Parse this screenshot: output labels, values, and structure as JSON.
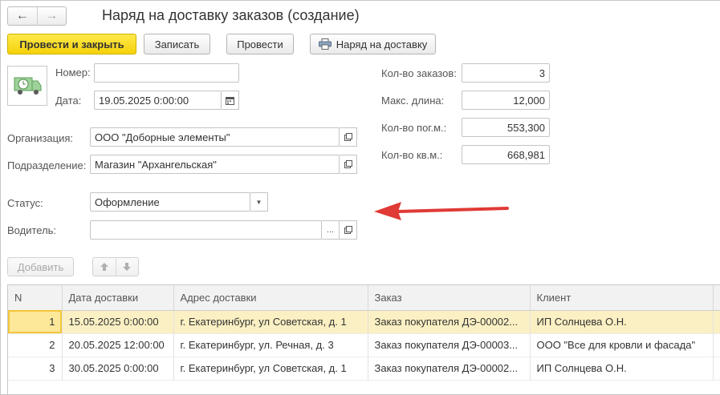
{
  "window": {
    "title": "Наряд на доставку заказов (создание)"
  },
  "nav": {
    "back": "←",
    "forward": "→"
  },
  "toolbar": {
    "post_close": "Провести и закрыть",
    "save": "Записать",
    "post": "Провести",
    "delivery_order": "Наряд на доставку"
  },
  "form": {
    "number_label": "Номер:",
    "number_value": "",
    "date_label": "Дата:",
    "date_value": "19.05.2025  0:00:00",
    "org_label": "Организация:",
    "org_value": "ООО \"Доборные элементы\"",
    "dept_label": "Подразделение:",
    "dept_value": "Магазин \"Архангельская\"",
    "status_label": "Статус:",
    "status_value": "Оформление",
    "driver_label": "Водитель:",
    "driver_value": "",
    "ellipsis": "..."
  },
  "stats": {
    "orders_label": "Кол-во заказов:",
    "orders_value": "3",
    "maxlen_label": "Макс. длина:",
    "maxlen_value": "12,000",
    "linm_label": "Кол-во пог.м.:",
    "linm_value": "553,300",
    "sqm_label": "Кол-во кв.м.:",
    "sqm_value": "668,981"
  },
  "table_toolbar": {
    "add": "Добавить",
    "up": "🡅",
    "down": "🡇"
  },
  "table": {
    "columns": [
      "N",
      "Дата доставки",
      "Адрес доставки",
      "Заказ",
      "Клиент"
    ],
    "rows": [
      [
        "1",
        "15.05.2025 0:00:00",
        "г. Екатеринбург, ул Советская, д. 1",
        "Заказ покупателя ДЭ-00002...",
        "ИП Солнцева О.Н."
      ],
      [
        "2",
        "20.05.2025 12:00:00",
        "г. Екатеринбург, ул. Речная, д. 3",
        "Заказ покупателя ДЭ-00003...",
        "ООО \"Все для кровли и фасада\""
      ],
      [
        "3",
        "30.05.2025 0:00:00",
        "г. Екатеринбург, ул Советская, д. 1",
        "Заказ покупателя ДЭ-00002...",
        "ИП Солнцева О.Н."
      ]
    ]
  },
  "colors": {
    "accent_yellow": "#f5d20a",
    "arrow_red": "#e03a36",
    "selected_row": "#fbf0c3"
  },
  "icons": [
    "truck-clock-icon",
    "printer-icon",
    "calendar-icon",
    "open-icon",
    "dropdown-icon",
    "arrow-left-icon",
    "arrow-right-icon",
    "arrow-up-icon",
    "arrow-down-icon"
  ]
}
